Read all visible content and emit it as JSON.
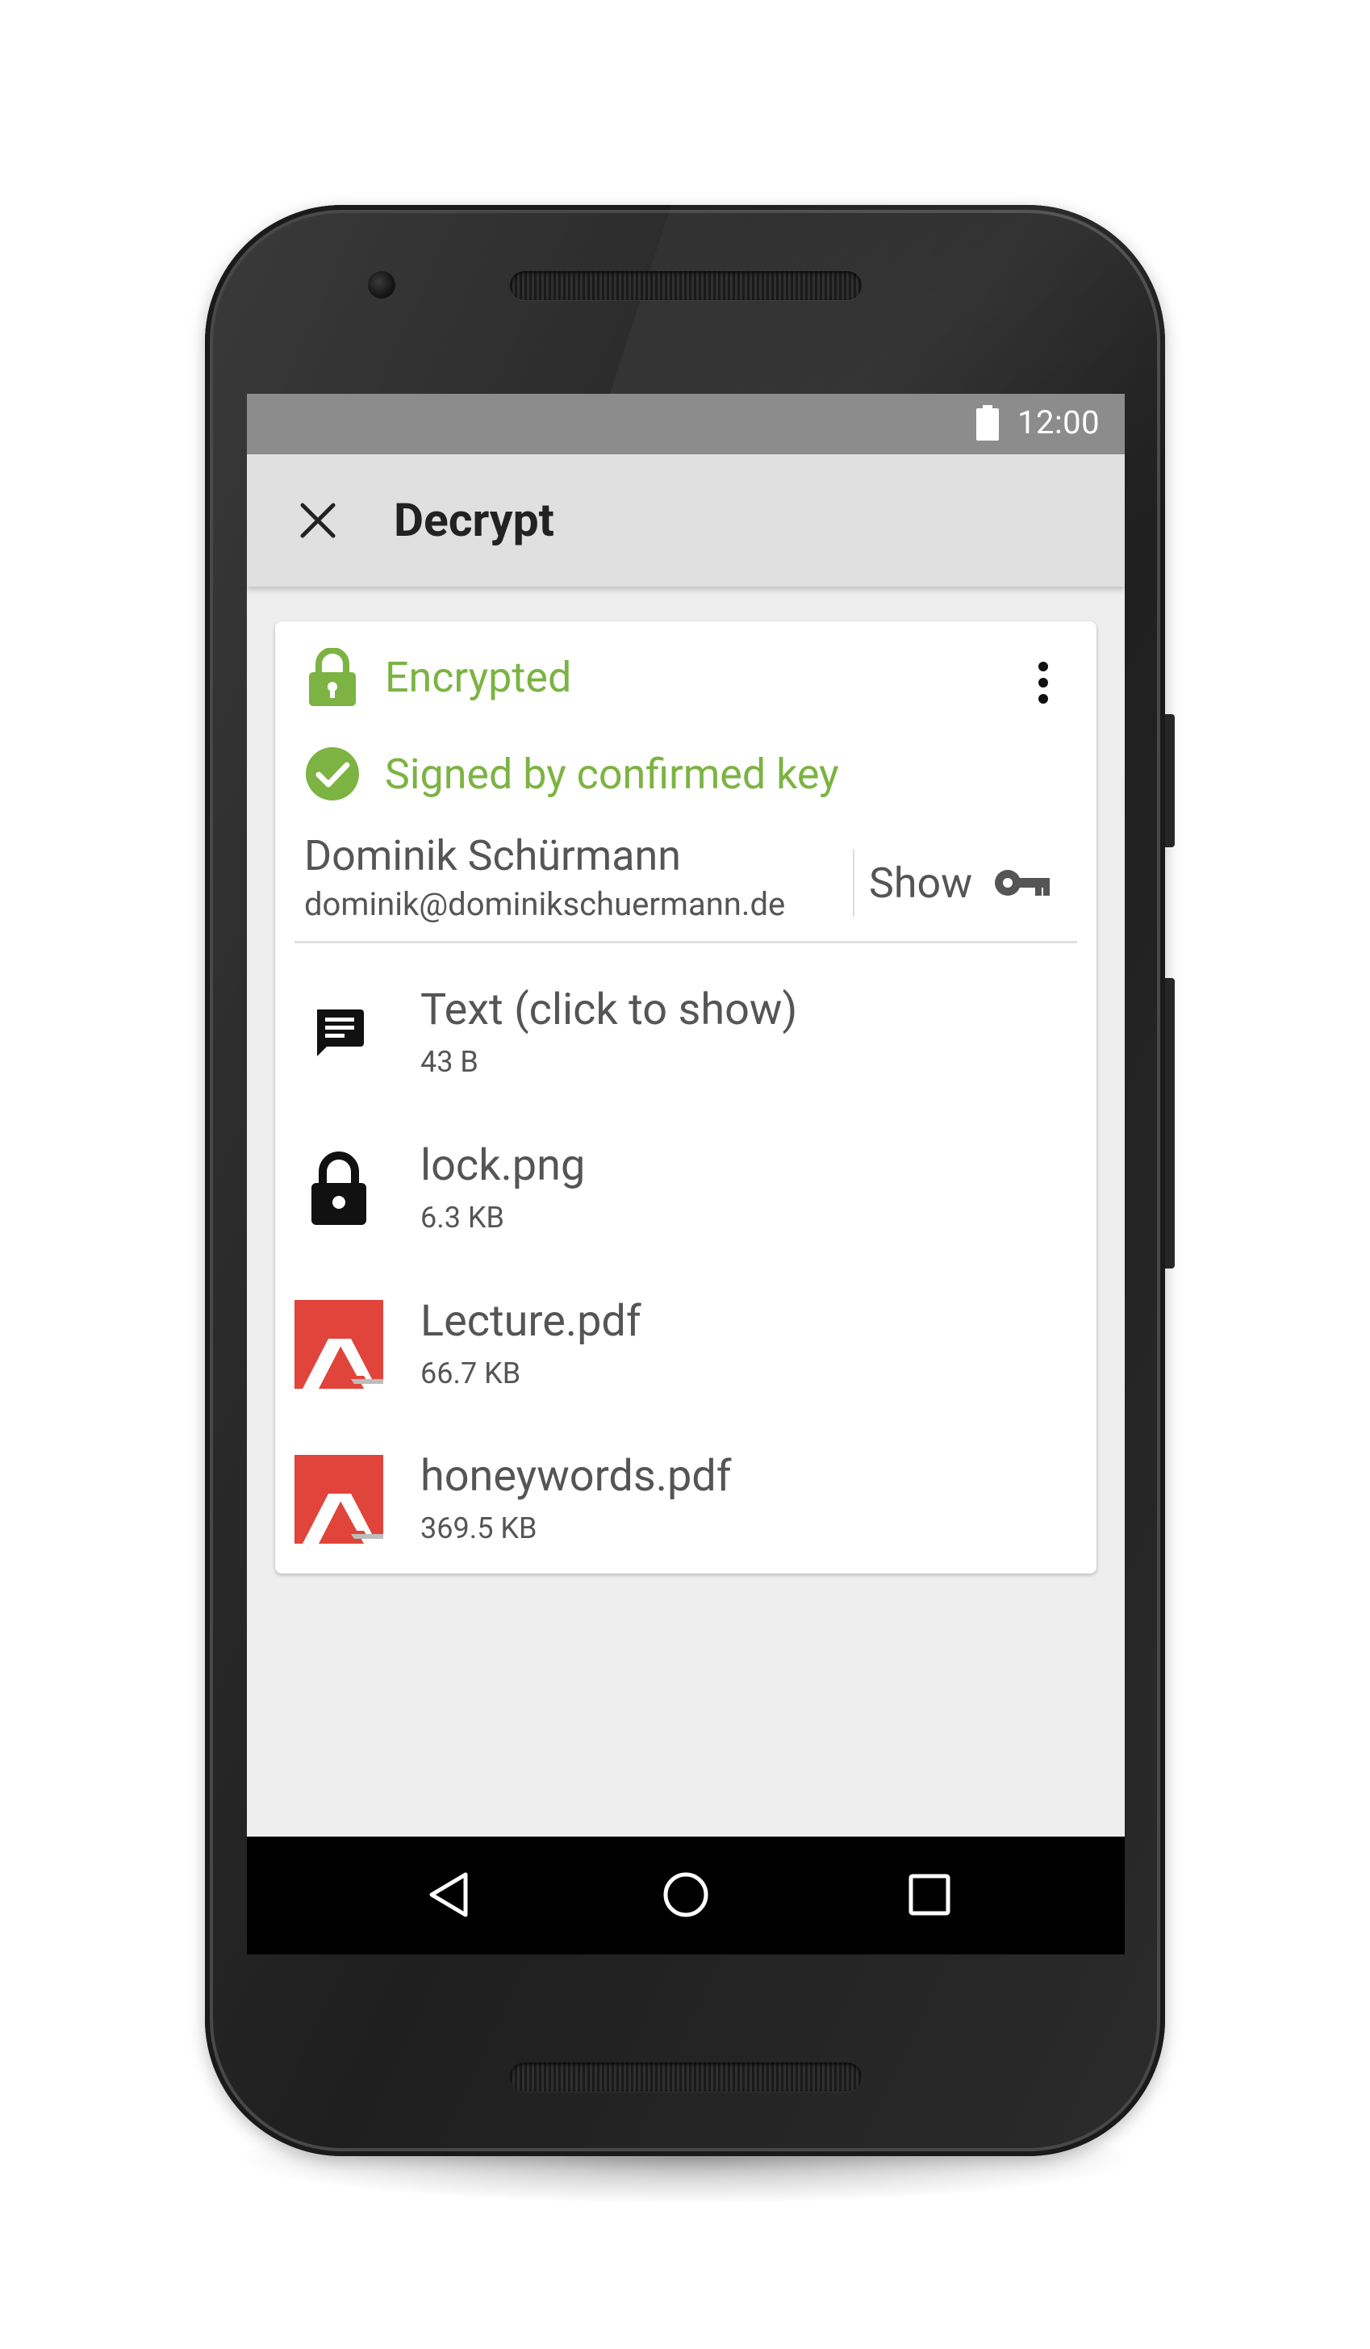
{
  "status_bar": {
    "time": "12:00",
    "icons": [
      "battery-icon"
    ]
  },
  "toolbar": {
    "title": "Decrypt",
    "close_icon": "close-icon"
  },
  "decrypt_result": {
    "encryption_status": "Encrypted",
    "signature_status": "Signed by confirmed key",
    "signer_name": "Dominik Schürmann",
    "signer_email": "dominik@dominikschuermann.de",
    "show_key_label": "Show",
    "colors": {
      "success": "#7cb342",
      "text_secondary": "#555555"
    }
  },
  "files": [
    {
      "name": "Text (click to show)",
      "size": "43 B",
      "icon": "message-icon"
    },
    {
      "name": "lock.png",
      "size": "6.3 KB",
      "icon": "lock-icon"
    },
    {
      "name": "Lecture.pdf",
      "size": "66.7 KB",
      "icon": "pdf-icon"
    },
    {
      "name": "honeywords.pdf",
      "size": "369.5 KB",
      "icon": "pdf-icon"
    }
  ],
  "nav_bar": {
    "buttons": [
      "back-icon",
      "home-icon",
      "recents-icon"
    ]
  }
}
